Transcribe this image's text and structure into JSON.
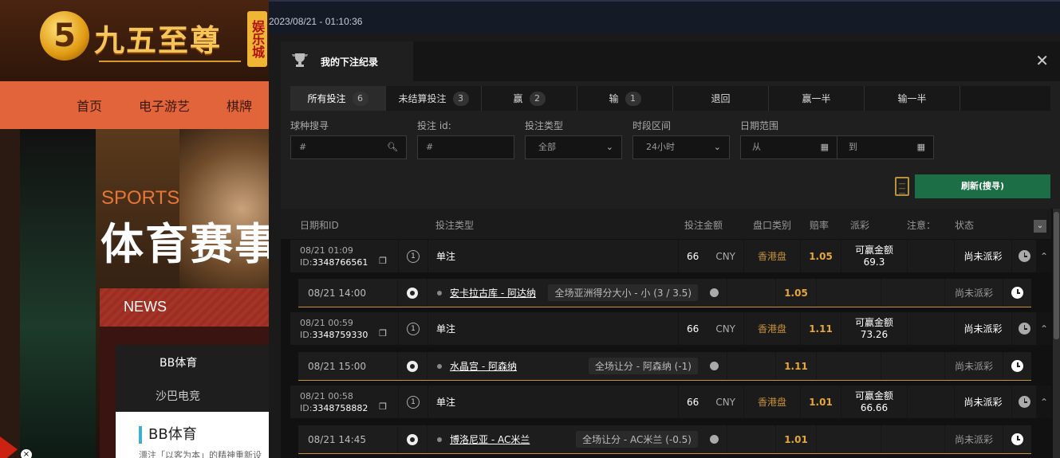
{
  "background_site": {
    "logo": {
      "mark": "5",
      "name": "九五至尊",
      "side": "娱乐城"
    },
    "nav": [
      "首页",
      "电子游艺",
      "棋牌"
    ],
    "hero": {
      "sports_en": "SPORTS",
      "sports_cn": "体育赛事"
    },
    "news": {
      "label": "NEWS",
      "tabs": [
        "BB体育",
        "沙巴电竞"
      ],
      "headline": "BB体育",
      "snippet": "漂注「以客为本」的精神重新设"
    },
    "close_symbol": "×"
  },
  "topbar": {
    "datetime": "2023/08/21 - 01:10:36"
  },
  "modal": {
    "title": "我的下注纪录",
    "close": "✕",
    "tabs": [
      {
        "label": "所有投注",
        "count": "6"
      },
      {
        "label": "未结算投注",
        "count": "3"
      },
      {
        "label": "赢",
        "count": "2"
      },
      {
        "label": "输",
        "count": "1"
      },
      {
        "label": "退回",
        "count": ""
      },
      {
        "label": "赢一半",
        "count": ""
      },
      {
        "label": "输一半",
        "count": ""
      }
    ],
    "filters": {
      "sport_search": {
        "label": "球种搜寻",
        "placeholder": "#"
      },
      "bet_id": {
        "label": "投注 id:",
        "placeholder": "#"
      },
      "bet_type": {
        "label": "投注类型",
        "value": "全部"
      },
      "time_range": {
        "label": "时段区间",
        "value": "24小时"
      },
      "date_range": {
        "label": "日期范围",
        "from": "从",
        "to": "到"
      }
    },
    "refresh_label": "刷新(搜寻)",
    "table": {
      "headers": [
        "日期和ID",
        "投注类型",
        "投注金额",
        "盘口类别",
        "赔率",
        "派彩",
        "注意：",
        "状态"
      ],
      "bets": [
        {
          "date": "08/21 01:09",
          "id_prefix": "ID:",
          "id": "3348766561",
          "type": "单注",
          "amount": "66",
          "currency": "CNY",
          "market": "香港盘",
          "odds": "1.05",
          "win_label": "可赢金额",
          "win": "69.3",
          "status": "尚未派彩",
          "sub": {
            "date": "08/21 14:00",
            "match": "安卡拉古库 - 阿达纳",
            "market": "全场亚洲得分大小 - 小 (3 / 3.5)",
            "odds": "1.05",
            "status": "尚未派彩"
          }
        },
        {
          "date": "08/21 00:59",
          "id_prefix": "ID:",
          "id": "3348759330",
          "type": "单注",
          "amount": "66",
          "currency": "CNY",
          "market": "香港盘",
          "odds": "1.11",
          "win_label": "可赢金额",
          "win": "73.26",
          "status": "尚未派彩",
          "sub": {
            "date": "08/21 15:00",
            "match": "水晶宫 - 阿森纳",
            "market": "全场让分 - 阿森纳 (-1)",
            "odds": "1.11",
            "status": "尚未派彩"
          }
        },
        {
          "date": "08/21 00:58",
          "id_prefix": "ID:",
          "id": "3348758882",
          "type": "单注",
          "amount": "66",
          "currency": "CNY",
          "market": "香港盘",
          "odds": "1.01",
          "win_label": "可赢金额",
          "win": "66.66",
          "status": "尚未派彩",
          "sub": {
            "date": "08/21 14:45",
            "match": "博洛尼亚 - AC米兰",
            "market": "全场让分 - AC米兰 (-0.5)",
            "odds": "1.01",
            "status": "尚未派彩"
          }
        }
      ]
    }
  }
}
